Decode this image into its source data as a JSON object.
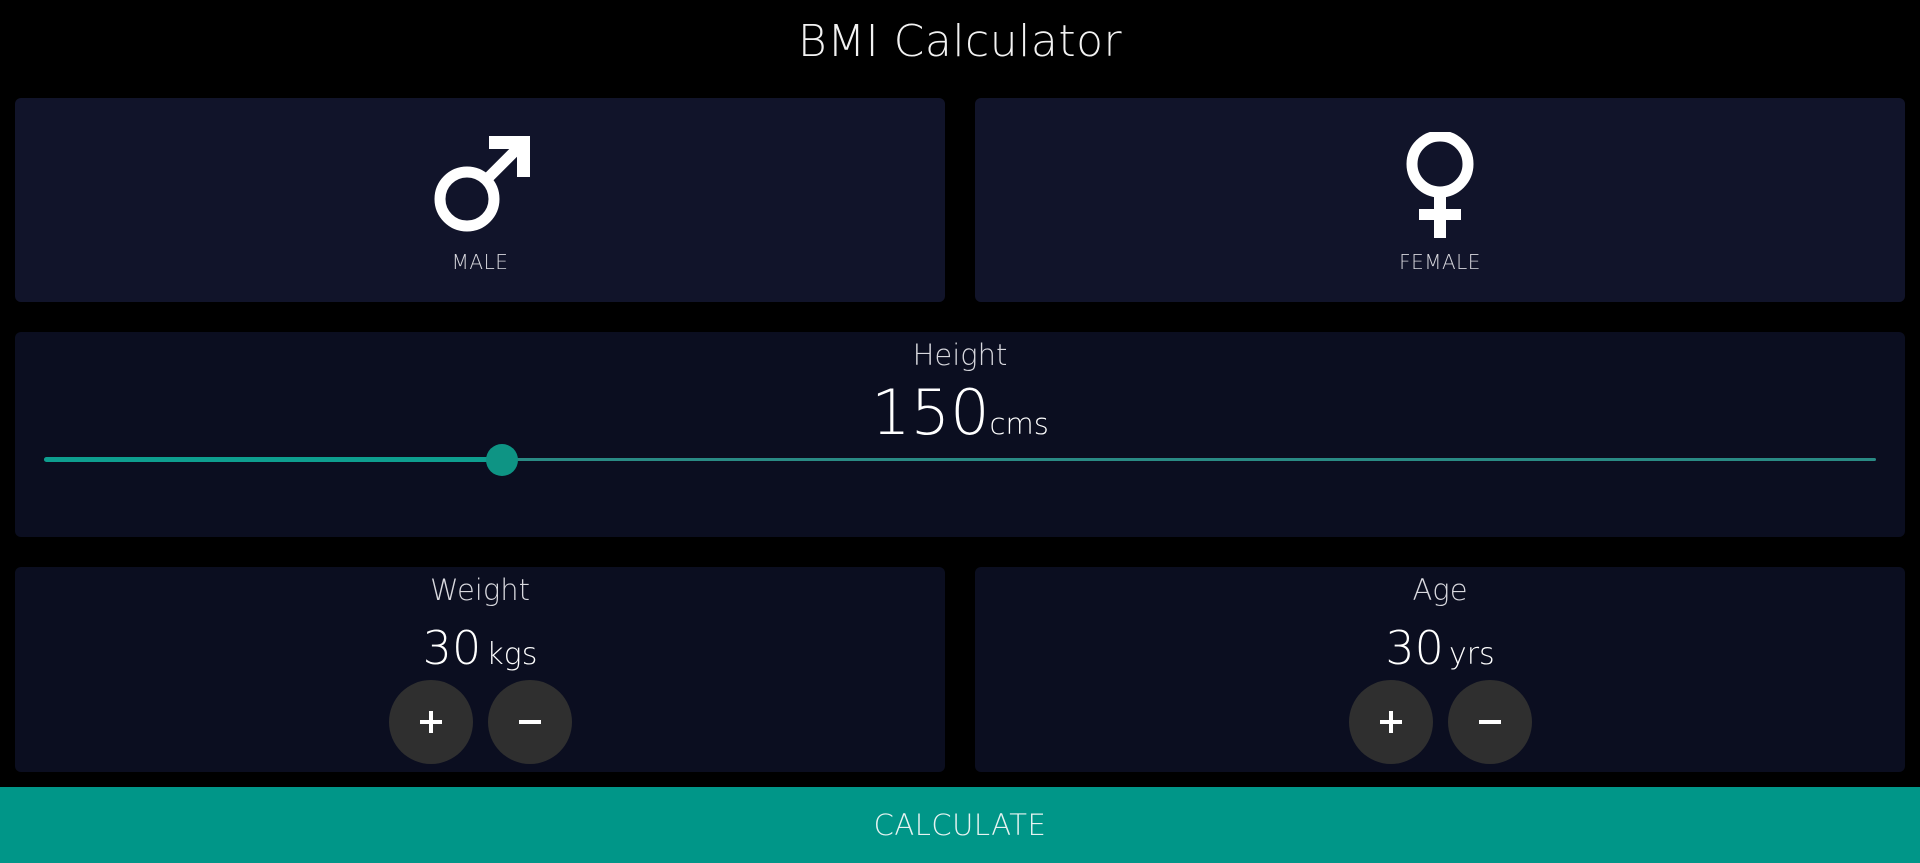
{
  "app": {
    "title": "BMI Calculator"
  },
  "gender": {
    "male_label": "MALE",
    "female_label": "FEMALE",
    "male_icon": "male-symbol-icon",
    "female_icon": "female-symbol-icon"
  },
  "height": {
    "label": "Height",
    "value": "150",
    "unit": "cms",
    "slider_fraction": 0.25
  },
  "weight": {
    "label": "Weight",
    "value": "30",
    "unit": "kgs",
    "increment_icon": "plus-icon",
    "decrement_icon": "minus-icon"
  },
  "age": {
    "label": "Age",
    "value": "30",
    "unit": "yrs",
    "increment_icon": "plus-icon",
    "decrement_icon": "minus-icon"
  },
  "actions": {
    "calculate_label": "CALCULATE"
  },
  "colors": {
    "background": "#000000",
    "card": "#11142a",
    "card_dark": "#0b0e20",
    "accent": "#009688",
    "button": "#2f2f2f"
  }
}
